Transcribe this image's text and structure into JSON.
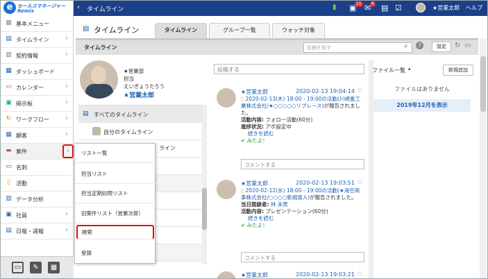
{
  "colors": {
    "topbar": "#1c3f8a",
    "link": "#1a5fb4",
    "highlight": "#d11",
    "ok": "#2a9d3a"
  },
  "logo": {
    "line1": "セールスマネージャー",
    "line2": "Remix"
  },
  "topbar": {
    "back_icon": "chevron-left-icon",
    "title": "タイムライン",
    "msg_count": "11",
    "mail_count": "6",
    "user": "★営業太郎",
    "help": "ヘルプ"
  },
  "sidebar": {
    "items": [
      {
        "label": "基本メニュー",
        "icon": "grid-icon"
      },
      {
        "label": "タイムライン",
        "icon": "timeline-icon"
      },
      {
        "label": "契約情報",
        "icon": "contract-icon"
      },
      {
        "label": "ダッシュボード",
        "icon": "dashboard-icon"
      },
      {
        "label": "カレンダー",
        "icon": "calendar-icon"
      },
      {
        "label": "掲示板",
        "icon": "board-icon"
      },
      {
        "label": "ワークフロー",
        "icon": "workflow-icon"
      },
      {
        "label": "顧客",
        "icon": "customer-icon"
      },
      {
        "label": "案件",
        "icon": "folder-icon"
      },
      {
        "label": "名刺",
        "icon": "card-icon"
      },
      {
        "label": "活動",
        "icon": "activity-icon"
      },
      {
        "label": "データ分析",
        "icon": "chart-icon"
      },
      {
        "label": "社員",
        "icon": "staff-icon"
      },
      {
        "label": "日報・週報",
        "icon": "report-icon"
      }
    ]
  },
  "page": {
    "title": "タイムライン",
    "tabs": [
      "タイムライン",
      "グループ一覧",
      "ウォッチ対象"
    ],
    "bar_label": "タイムライン",
    "search_placeholder": "投稿を探す",
    "settings": "設定"
  },
  "profile": {
    "line1": "★営業部",
    "line2": "担当",
    "line3": "えいぎょうたろう",
    "name": "★営業太郎"
  },
  "timelines": {
    "all": "すべてのタイムライン",
    "mine": "自分のタイムライン",
    "partial": "ライン"
  },
  "popup": {
    "items": [
      "リスト一覧",
      "担当リスト",
      "担当定期訪問リスト",
      "旧案件リスト（営業次郎）",
      "検索",
      "登録"
    ]
  },
  "feed": {
    "post_placeholder": "投稿する",
    "comment_placeholder": "コメントする",
    "posts": [
      {
        "name": "★営業太郎",
        "date": "2020-02-13 19:04:14",
        "link": "2020-02-13(木) 18:00 - 19:00の活動(川崎重工業株式会社/★○○○○○リプレース)",
        "suffix": "が報告されました。",
        "f1k": "活動内容:",
        "f1v": "フォロー活動(60分)",
        "f2k": "進捗状況:",
        "f2v": "アポ設定中",
        "more": "続きを読む",
        "like": "みたよ！"
      },
      {
        "name": "★営業太郎",
        "date": "2020-02-13 19:03:51",
        "link": "2020-02-12(水) 18:00 - 19:00の活動(★海空商事株式会社/○○○○新規導入)",
        "suffix": "が報告されました。",
        "f1k": "当日面談者:",
        "f1v": "林 末男",
        "f2k": "活動内容:",
        "f2v": "プレゼンテーション(60分)",
        "more": "続きを読む",
        "like": "みたよ！"
      },
      {
        "name": "★営業太郎",
        "date": "2020-02-13 19:03:21"
      }
    ]
  },
  "files": {
    "title": "ファイル一覧",
    "new_btn": "新規追加",
    "empty": "ファイルはありません",
    "month": "2019年12月を表示"
  }
}
